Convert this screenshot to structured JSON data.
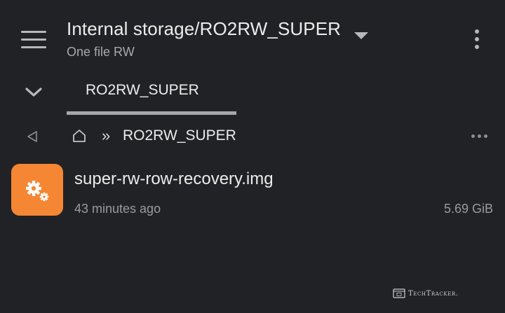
{
  "header": {
    "title": "Internal storage/RO2RW_SUPER",
    "subtitle": "One file RW",
    "menu_icon": "hamburger-menu-icon",
    "dropdown_icon": "caret-down-icon",
    "overflow_icon": "more-vertical-icon"
  },
  "tabs": {
    "collapse_icon": "chevron-down-icon",
    "items": [
      {
        "label": "RO2RW_SUPER",
        "selected": true
      }
    ]
  },
  "breadcrumb": {
    "back_icon": "triangle-left-icon",
    "home_icon": "home-icon",
    "separator": "»",
    "current": "RO2RW_SUPER",
    "more_icon": "more-horizontal-icon"
  },
  "files": [
    {
      "name": "super-rw-row-recovery.img",
      "modified": "43 minutes ago",
      "size": "5.69 GiB",
      "icon": "gears-icon",
      "icon_color": "#f58633"
    }
  ],
  "watermark": {
    "text": "TechTracker."
  },
  "colors": {
    "background": "#212226",
    "accent": "#f58633",
    "tab_indicator": "#a6a7aa"
  }
}
